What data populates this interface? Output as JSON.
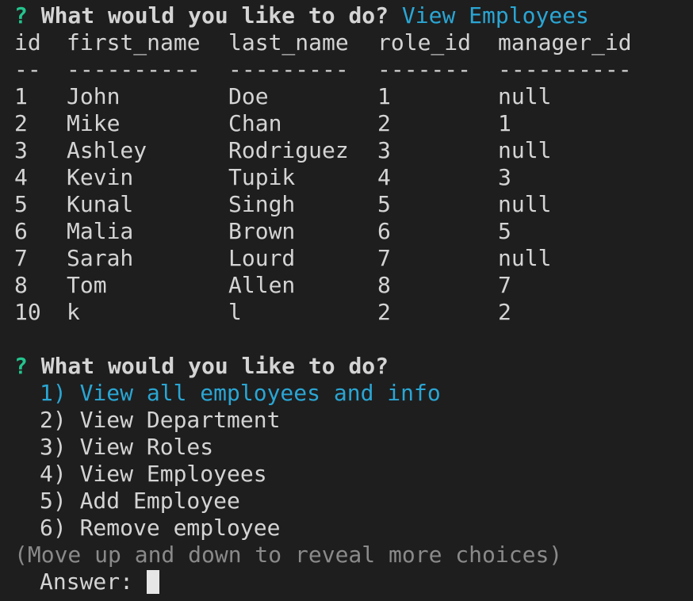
{
  "prompt1": {
    "marker": "?",
    "question": "What would you like to do?",
    "answer": "View Employees"
  },
  "table": {
    "headers": [
      "id",
      "first_name",
      "last_name",
      "role_id",
      "manager_id"
    ],
    "separators": [
      "--",
      "----------",
      "---------",
      "-------",
      "----------"
    ],
    "rows": [
      [
        "1",
        "John",
        "Doe",
        "1",
        "null"
      ],
      [
        "2",
        "Mike",
        "Chan",
        "2",
        "1"
      ],
      [
        "3",
        "Ashley",
        "Rodriguez",
        "3",
        "null"
      ],
      [
        "4",
        "Kevin",
        "Tupik",
        "4",
        "3"
      ],
      [
        "5",
        "Kunal",
        "Singh",
        "5",
        "null"
      ],
      [
        "6",
        "Malia",
        "Brown",
        "6",
        "5"
      ],
      [
        "7",
        "Sarah",
        "Lourd",
        "7",
        "null"
      ],
      [
        "8",
        "Tom",
        "Allen",
        "8",
        "7"
      ],
      [
        "10",
        "k",
        "l",
        "2",
        "2"
      ]
    ]
  },
  "prompt2": {
    "marker": "?",
    "question": "What would you like to do?",
    "choices": [
      "1) View all employees and info",
      "2) View Department",
      "3) View Roles",
      "4) View Employees",
      "5) Add Employee",
      "6) Remove employee"
    ],
    "selected_index": 0,
    "hint": "(Move up and down to reveal more choices)",
    "answer_label": "Answer:"
  },
  "colors": {
    "background": "#1e1e1e",
    "text": "#d4d4d4",
    "prompt_marker": "#23c48e",
    "highlight": "#2aa6d4",
    "hint": "#8a8a8a"
  }
}
